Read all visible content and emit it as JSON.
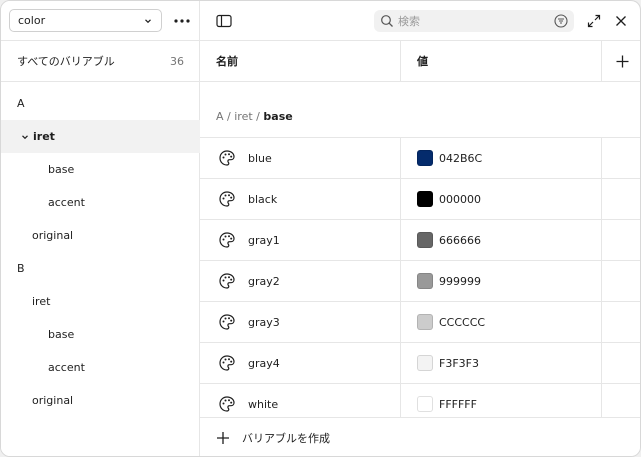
{
  "sidebar": {
    "collection": {
      "value": "color"
    },
    "all_variables": {
      "label": "すべてのバリアブル",
      "count": "36"
    },
    "tree": [
      {
        "label": "A",
        "indent": 0,
        "chevron": false,
        "selected": false
      },
      {
        "label": "iret",
        "indent": 1,
        "chevron": true,
        "selected": true
      },
      {
        "label": "base",
        "indent": 2,
        "chevron": false,
        "selected": false
      },
      {
        "label": "accent",
        "indent": 2,
        "chevron": false,
        "selected": false
      },
      {
        "label": "original",
        "indent": 1,
        "chevron": false,
        "selected": false
      },
      {
        "label": "B",
        "indent": 0,
        "chevron": false,
        "selected": false
      },
      {
        "label": "iret",
        "indent": 1,
        "chevron": false,
        "selected": false
      },
      {
        "label": "base",
        "indent": 2,
        "chevron": false,
        "selected": false
      },
      {
        "label": "accent",
        "indent": 2,
        "chevron": false,
        "selected": false
      },
      {
        "label": "original",
        "indent": 1,
        "chevron": false,
        "selected": false
      }
    ]
  },
  "toolbar": {
    "search_placeholder": "検索"
  },
  "table": {
    "header_name": "名前",
    "header_value": "値",
    "breadcrumb": {
      "part1": "A",
      "sep": "/",
      "part2": "iret",
      "current": "base"
    },
    "rows": [
      {
        "name": "blue",
        "value": "042B6C",
        "color": "#042B6C"
      },
      {
        "name": "black",
        "value": "000000",
        "color": "#000000"
      },
      {
        "name": "gray1",
        "value": "666666",
        "color": "#666666"
      },
      {
        "name": "gray2",
        "value": "999999",
        "color": "#999999"
      },
      {
        "name": "gray3",
        "value": "CCCCCC",
        "color": "#CCCCCC"
      },
      {
        "name": "gray4",
        "value": "F3F3F3",
        "color": "#F3F3F3"
      },
      {
        "name": "white",
        "value": "FFFFFF",
        "color": "#FFFFFF"
      }
    ]
  },
  "footer": {
    "create_label": "バリアブルを作成"
  }
}
